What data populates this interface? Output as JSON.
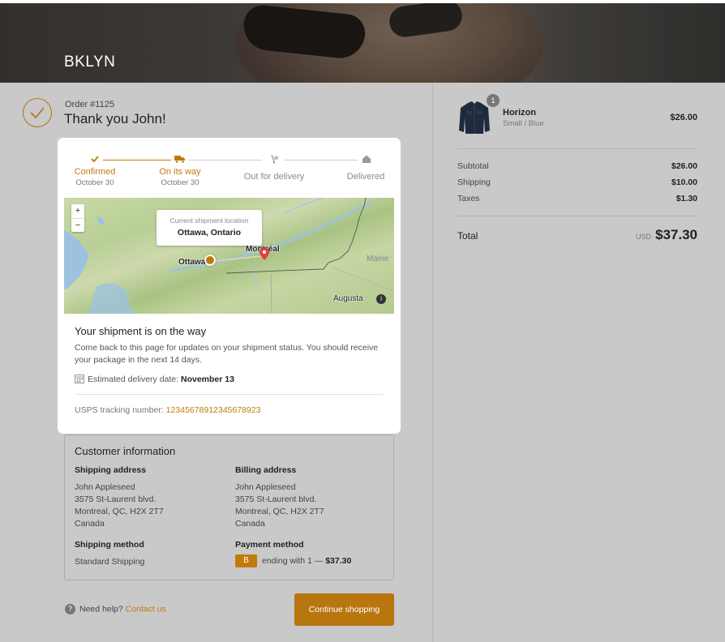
{
  "brand": "BKLYN",
  "order": {
    "number": "Order #1125",
    "thanks": "Thank you John!"
  },
  "steps": [
    {
      "label": "Confirmed",
      "date": "October 30",
      "icon": "check-icon"
    },
    {
      "label": "On its way",
      "date": "October 30",
      "icon": "truck-icon"
    },
    {
      "label": "Out for delivery",
      "date": "",
      "icon": "dolly-icon"
    },
    {
      "label": "Delivered",
      "date": "",
      "icon": "house-icon"
    }
  ],
  "map": {
    "tooltip_title": "Current shipment location",
    "tooltip_location": "Ottawa, Ontario",
    "labels": {
      "ottawa": "Ottawa",
      "montreal": "Montréal",
      "maine": "Maine",
      "augusta": "Augusta"
    },
    "zoom_in": "+",
    "zoom_out": "−",
    "info": "i"
  },
  "shipment": {
    "title": "Your shipment is on the way",
    "desc": "Come back to this page for updates on your shipment status. You should receive your package in the next 14 days.",
    "eta_label": "Estimated delivery date:",
    "eta_value": "November 13",
    "tracking_label": "USPS tracking number:",
    "tracking_number": "12345678912345678923"
  },
  "customer": {
    "title": "Customer information",
    "shipping_address_title": "Shipping address",
    "shipping_address": [
      "John Appleseed",
      "3575 St-Laurent blvd.",
      "Montreal, QC, H2X 2T7",
      "Canada"
    ],
    "billing_address_title": "Billing address",
    "billing_address": [
      "John Appleseed",
      "3575 St-Laurent blvd.",
      "Montreal, QC, H2X 2T7",
      "Canada"
    ],
    "shipping_method_title": "Shipping method",
    "shipping_method": "Standard Shipping",
    "payment_method_title": "Payment method",
    "payment_badge": "B",
    "payment_text": "ending with 1 —",
    "payment_amount": "$37.30"
  },
  "footer": {
    "help": "Need help?",
    "contact": "Contact us",
    "continue": "Continue shopping"
  },
  "summary": {
    "product": {
      "qty": "1",
      "name": "Horizon",
      "variant": "Small / Blue",
      "price": "$26.00"
    },
    "subtotal_label": "Subtotal",
    "subtotal": "$26.00",
    "shipping_label": "Shipping",
    "shipping": "$10.00",
    "taxes_label": "Taxes",
    "taxes": "$1.30",
    "total_label": "Total",
    "currency": "USD",
    "total": "$37.30"
  },
  "colors": {
    "accent": "#c27b0b",
    "button": "#b8760e"
  }
}
